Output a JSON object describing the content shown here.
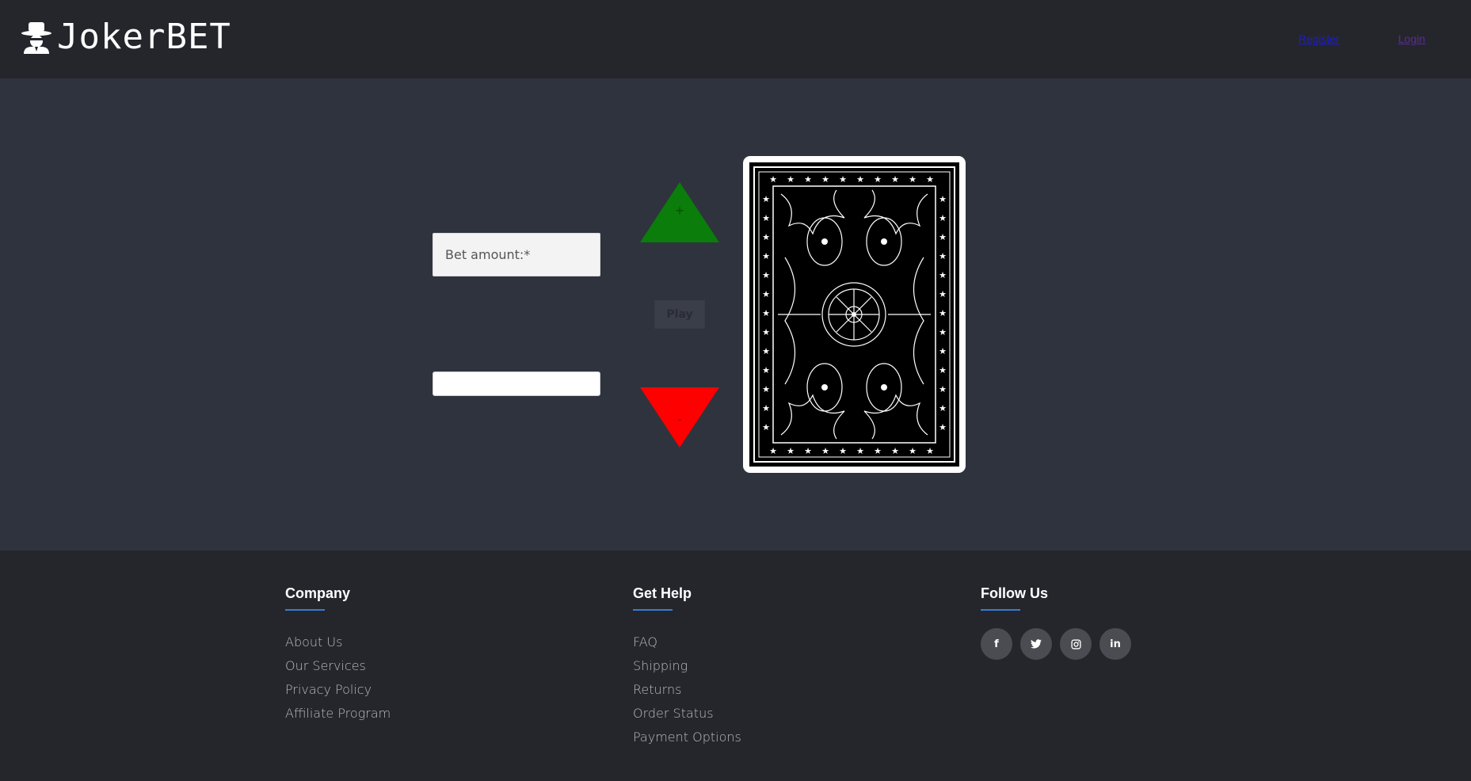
{
  "header": {
    "brand": "JokerBET",
    "nav": {
      "signup": "Register",
      "login": "Login"
    }
  },
  "game": {
    "bet_placeholder": "Bet amount:*",
    "result_value": "",
    "up_label": "+",
    "down_label": "-",
    "play_label": "Play",
    "colors": {
      "up": "#0a7d0a",
      "down": "#ff0000"
    }
  },
  "footer": {
    "company": {
      "title": "Company",
      "links": [
        "About Us",
        "Our Services",
        "Privacy Policy",
        "Affiliate Program"
      ]
    },
    "help": {
      "title": "Get Help",
      "links": [
        "FAQ",
        "Shipping",
        "Returns",
        "Order Status",
        "Payment Options"
      ]
    },
    "follow": {
      "title": "Follow Us",
      "icons": [
        "facebook-icon",
        "twitter-icon",
        "instagram-icon",
        "linkedin-icon"
      ]
    },
    "accent": "#3a7bd5"
  }
}
